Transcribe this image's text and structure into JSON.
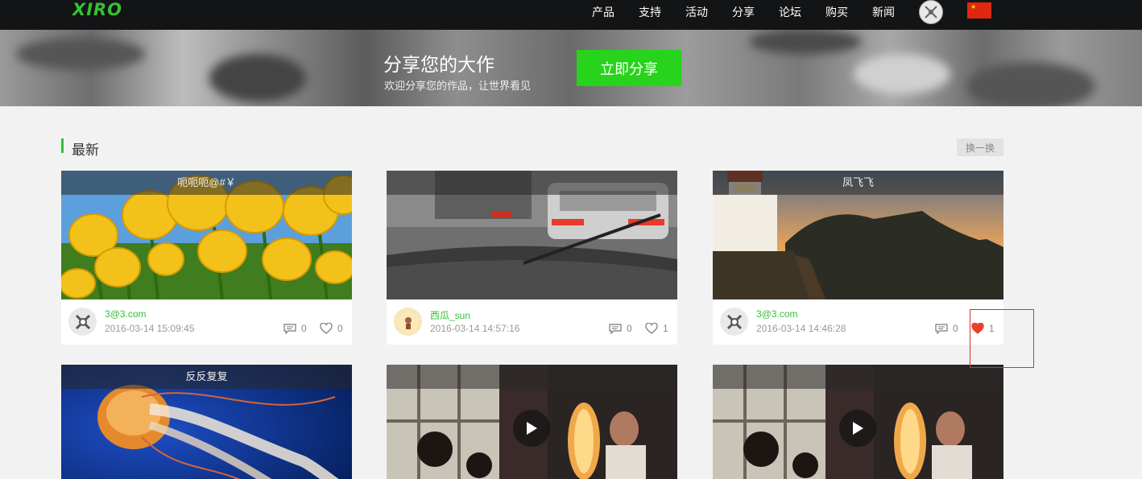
{
  "header": {
    "logo": "XIRO",
    "nav": [
      "产品",
      "支持",
      "活动",
      "分享",
      "论坛",
      "购买",
      "新闻"
    ],
    "colors": {
      "bg": "#131415",
      "brand": "#35c134"
    }
  },
  "banner": {
    "title": "分享您的大作",
    "subtitle": "欢迎分享您的作品，让世界看见",
    "button": "立即分享"
  },
  "section": {
    "title": "最新",
    "refresh_label": "换一换"
  },
  "cards": [
    {
      "caption": "呃呃呃@#￥",
      "user": "3@3.com",
      "time": "2016-03-14 15:09:45",
      "comments": "0",
      "likes": "0",
      "liked": false,
      "image": "tulips"
    },
    {
      "caption": "",
      "user": "西瓜_sun",
      "time": "2016-03-14 14:57:16",
      "comments": "0",
      "likes": "1",
      "liked": false,
      "image": "car-windshield"
    },
    {
      "caption": "凤飞飞",
      "user": "3@3.com",
      "time": "2016-03-14 14:46:28",
      "comments": "0",
      "likes": "1",
      "liked": true,
      "image": "lighthouse"
    },
    {
      "caption": "反反复复",
      "image": "jellyfish"
    },
    {
      "caption": "",
      "image": "video-room"
    },
    {
      "caption": "",
      "image": "video-room"
    }
  ]
}
